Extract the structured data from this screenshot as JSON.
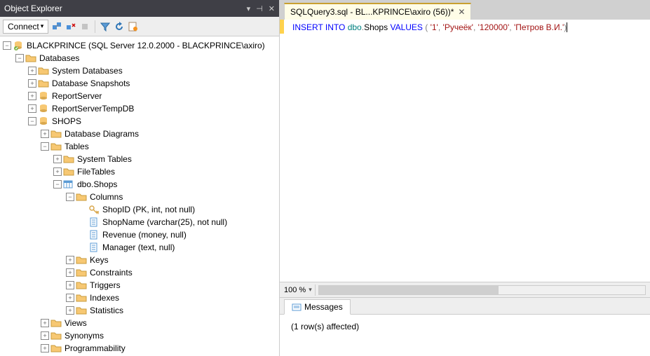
{
  "panel": {
    "title": "Object Explorer"
  },
  "toolbar": {
    "connect": "Connect"
  },
  "tree": {
    "server": "BLACKPRINCE (SQL Server 12.0.2000 - BLACKPRINCE\\axiro)",
    "databases": "Databases",
    "sysdb": "System Databases",
    "snap": "Database Snapshots",
    "reportserver": "ReportServer",
    "reportservertmp": "ReportServerTempDB",
    "shops": "SHOPS",
    "diagrams": "Database Diagrams",
    "tables": "Tables",
    "systables": "System Tables",
    "filetables": "FileTables",
    "dbo_shops": "dbo.Shops",
    "columns": "Columns",
    "col_shopid": "ShopID (PK, int, not null)",
    "col_shopname": "ShopName (varchar(25), not null)",
    "col_revenue": "Revenue (money, null)",
    "col_manager": "Manager (text, null)",
    "keys": "Keys",
    "constraints": "Constraints",
    "triggers": "Triggers",
    "indexes": "Indexes",
    "statistics": "Statistics",
    "views": "Views",
    "synonyms": "Synonyms",
    "programmability": "Programmability"
  },
  "tab": {
    "title": "SQLQuery3.sql - BL...KPRINCE\\axiro (56))*"
  },
  "sql": {
    "kw1": "INSERT INTO",
    "schema": "dbo",
    "dot": ".",
    "table": "Shops",
    "kw2": "VALUES",
    "lp": " ( ",
    "v1": "'1'",
    "c": ", ",
    "v2": "'Ручеёк'",
    "v3": "'120000'",
    "v4": "'Петров В.И.'",
    "rp": ")"
  },
  "zoom": {
    "value": "100 %"
  },
  "messages": {
    "tab": "Messages",
    "text": "(1 row(s) affected)"
  }
}
